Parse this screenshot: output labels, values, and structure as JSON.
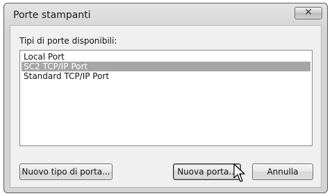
{
  "window": {
    "title": "Porte stampanti",
    "close_glyph": "✕"
  },
  "ports_label": "Tipi di porte disponibili:",
  "ports": [
    {
      "label": "Local Port",
      "selected": false
    },
    {
      "label": "SC2 TCP/IP Port",
      "selected": true
    },
    {
      "label": "Standard TCP/IP Port",
      "selected": false
    }
  ],
  "buttons": {
    "new_port_type": "Nuovo tipo di porta...",
    "new_port": "Nuova porta...",
    "cancel": "Annulla"
  },
  "colors": {
    "selection": "#a6a6a6"
  },
  "icons": {
    "cursor": "mouse-pointer-icon"
  }
}
